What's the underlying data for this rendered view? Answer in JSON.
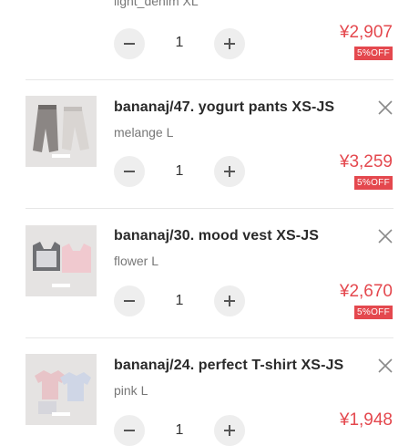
{
  "cart": {
    "items": [
      {
        "title": "",
        "variant": "light_denim XL",
        "quantity": "1",
        "price": "¥2,907",
        "discount": "5%OFF",
        "thumb_colors": [
          "#c8d4e4",
          "#dfe3ea"
        ]
      },
      {
        "title": "bananaj/47. yogurt pants XS-JS",
        "variant": "melange L",
        "quantity": "1",
        "price": "¥3,259",
        "discount": "5%OFF",
        "thumb_colors": [
          "#8b8684",
          "#d9d5d2"
        ]
      },
      {
        "title": "bananaj/30. mood vest XS-JS",
        "variant": "flower L",
        "quantity": "1",
        "price": "¥2,670",
        "discount": "5%OFF",
        "thumb_colors": [
          "#6f7074",
          "#f0c9cf"
        ]
      },
      {
        "title": "bananaj/24. perfect T-shirt XS-JS",
        "variant": "pink L",
        "quantity": "1",
        "price": "¥1,948",
        "discount": "5%OFF",
        "thumb_colors": [
          "#e8c4c8",
          "#cfd6e6"
        ]
      }
    ]
  },
  "colors": {
    "price": "#e4484e",
    "button_bg": "#eeeeee",
    "divider": "#e6e6e6"
  },
  "icons": {
    "remove": "close-icon",
    "decrease": "minus-icon",
    "increase": "plus-icon"
  }
}
